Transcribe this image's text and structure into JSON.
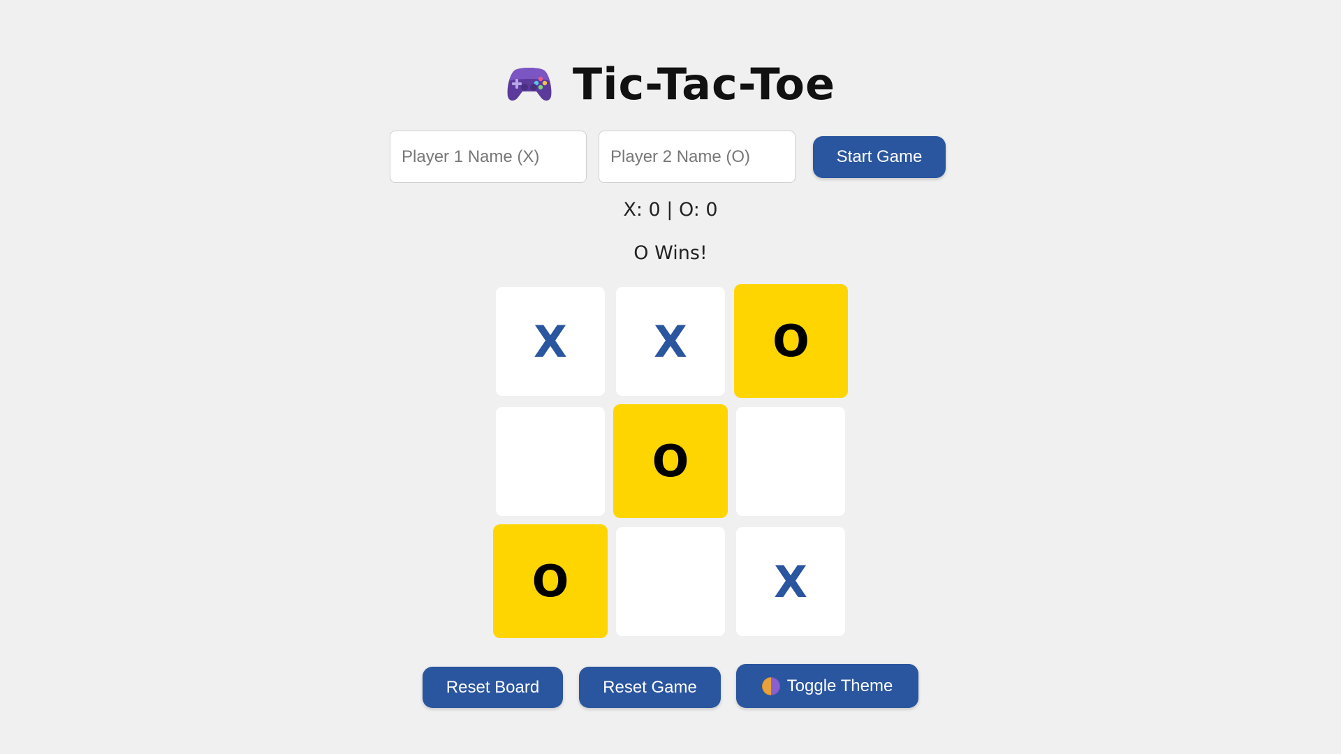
{
  "header": {
    "title": "Tic-Tac-Toe",
    "icon": "game-controller-icon"
  },
  "setup": {
    "player1_placeholder": "Player 1 Name (X)",
    "player1_value": "",
    "player2_placeholder": "Player 2 Name (O)",
    "player2_value": "",
    "start_label": "Start Game"
  },
  "score": {
    "text": "X: 0 | O: 0",
    "x": 0,
    "o": 0
  },
  "status": {
    "text": "O Wins!"
  },
  "board": {
    "cells": [
      "X",
      "X",
      "O",
      "",
      "O",
      "",
      "O",
      "",
      "X"
    ],
    "winning_cells": [
      2,
      4,
      6
    ],
    "winner": "O"
  },
  "controls": {
    "reset_board_label": "Reset Board",
    "reset_game_label": "Reset Game",
    "toggle_theme_label": "Toggle Theme",
    "toggle_theme_icon": "theme-moon-icon"
  },
  "colors": {
    "background": "#f0f0f0",
    "button": "#2a559f",
    "x_mark": "#2a559f",
    "o_mark": "#000000",
    "win_highlight": "#ffd500",
    "cell": "#ffffff"
  }
}
